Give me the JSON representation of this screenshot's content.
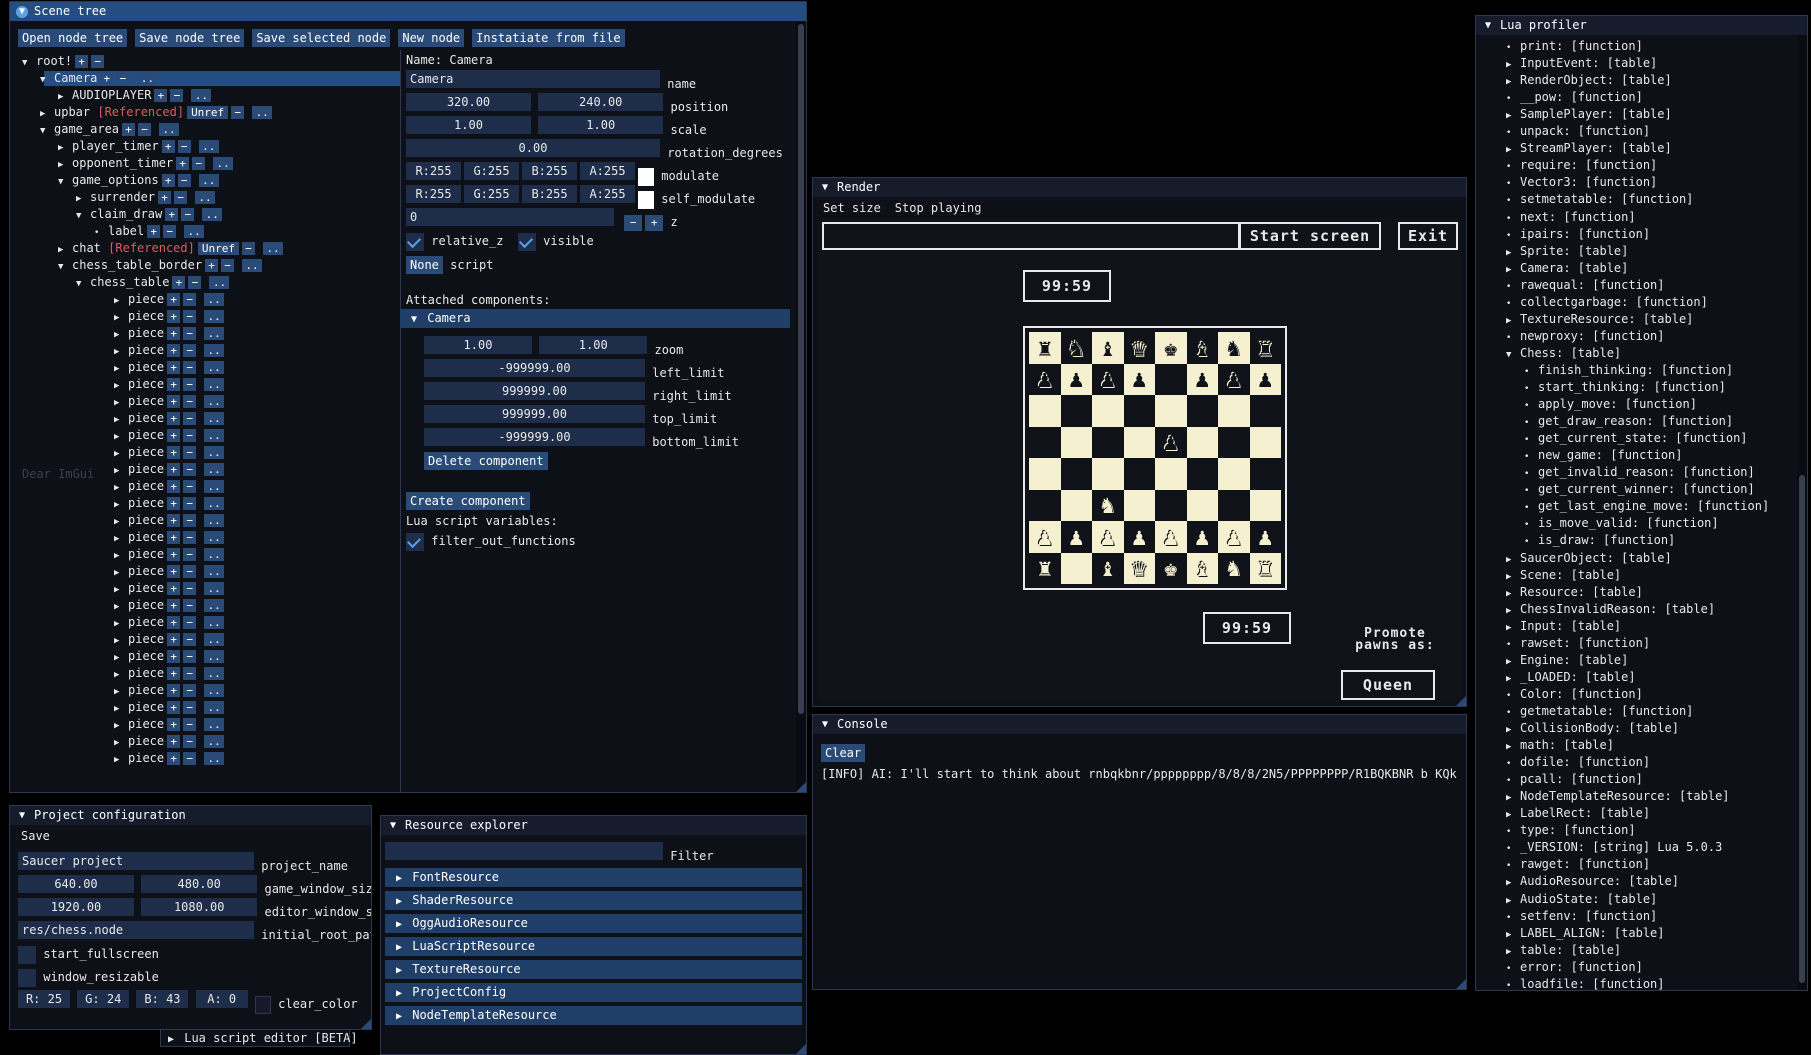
{
  "scene_tree": {
    "title": "Scene tree",
    "toolbar": [
      "Open node tree",
      "Save node tree",
      "Save selected node",
      "New node",
      "Instatiate from file"
    ],
    "nodes": [
      {
        "label": "root!",
        "arrow": "▼",
        "btns": [
          "+",
          "−"
        ]
      },
      {
        "label": "Camera",
        "arrow": "▼",
        "btns": [
          "+",
          "−",
          ".."
        ],
        "selected": true
      },
      {
        "label": "AUDIOPLAYER",
        "arrow": "▶",
        "btns": [
          "+",
          "−",
          ".."
        ]
      },
      {
        "label": "upbar",
        "arrow": "▶",
        "ref": "[Referenced]",
        "unref": "Unref",
        "btns": [
          "−",
          ".."
        ]
      },
      {
        "label": "game_area",
        "arrow": "▼",
        "btns": [
          "+",
          "−",
          ".."
        ]
      },
      {
        "label": "player_timer",
        "arrow": "▶",
        "btns": [
          "+",
          "−",
          ".."
        ]
      },
      {
        "label": "opponent_timer",
        "arrow": "▶",
        "btns": [
          "+",
          "−",
          ".."
        ]
      },
      {
        "label": "game_options",
        "arrow": "▼",
        "btns": [
          "+",
          "−",
          ".."
        ]
      },
      {
        "label": "surrender",
        "arrow": "▶",
        "btns": [
          "+",
          "−",
          ".."
        ]
      },
      {
        "label": "claim_draw",
        "arrow": "▼",
        "btns": [
          "+",
          "−",
          ".."
        ]
      },
      {
        "label": "label",
        "arrow": "•",
        "btns": [
          "+",
          "−",
          ".."
        ]
      },
      {
        "label": "chat",
        "arrow": "▶",
        "ref": "[Referenced]",
        "unref": "Unref",
        "btns": [
          "−",
          ".."
        ]
      },
      {
        "label": "chess_table_border",
        "arrow": "▼",
        "btns": [
          "+",
          "−",
          ".."
        ]
      },
      {
        "label": "chess_table",
        "arrow": "▼",
        "btns": [
          "+",
          "−",
          ".."
        ]
      }
    ],
    "piece_label": "piece",
    "ghost_label": "Dear ImGui",
    "inspector": {
      "name_line": "Name: Camera",
      "name_value": "Camera",
      "name_label": "name",
      "pos_x": "320.00",
      "pos_y": "240.00",
      "pos_label": "position",
      "scale_x": "1.00",
      "scale_y": "1.00",
      "scale_label": "scale",
      "rotation": "0.00",
      "rotation_label": "rotation_degrees",
      "modulate": [
        "R:255",
        "G:255",
        "B:255",
        "A:255"
      ],
      "modulate_label": "modulate",
      "self_modulate": [
        "R:255",
        "G:255",
        "B:255",
        "A:255"
      ],
      "self_modulate_label": "self_modulate",
      "z": "0",
      "z_minus": "−",
      "z_plus": "+",
      "z_label": "z",
      "relative_z": "relative_z",
      "visible": "visible",
      "script_btn": "None",
      "script_label": "script",
      "attached": "Attached components:",
      "component": "Camera",
      "zoom_x": "1.00",
      "zoom_y": "1.00",
      "zoom_label": "zoom",
      "left_limit": "-999999.00",
      "left_label": "left_limit",
      "right_limit": "999999.00",
      "right_label": "right_limit",
      "top_limit": "999999.00",
      "top_label": "top_limit",
      "bottom_limit": "-999999.00",
      "bottom_label": "bottom_limit",
      "delete_btn": "Delete component",
      "create_btn": "Create component",
      "lua_vars": "Lua script variables:",
      "filter_out": "filter_out_functions"
    }
  },
  "render": {
    "title": "Render",
    "menu": [
      "Set size",
      "Stop playing"
    ],
    "start_btn": "Start screen",
    "exit_btn": "Exit",
    "timer_top": "99:59",
    "timer_bottom": "99:59",
    "promote": "Promote pawns as:",
    "queen": "Queen",
    "board": [
      "rnbqkbnr",
      "pppp.ppp",
      "........",
      "....p...",
      "........",
      "..N.....",
      "PPPPPPPP",
      "R.BQKBNR"
    ]
  },
  "console": {
    "title": "Console",
    "clear": "Clear",
    "line": "[INFO]    AI: I'll start to think about rnbqkbnr/pppppppp/8/8/8/2N5/PPPPPPPP/R1BQKBNR b KQk"
  },
  "project": {
    "title": "Project configuration",
    "save": "Save",
    "project_name": "Saucer project",
    "project_name_label": "project_name",
    "gw_x": "640.00",
    "gw_y": "480.00",
    "gw_label": "game_window_size",
    "ew_x": "1920.00",
    "ew_y": "1080.00",
    "ew_label": "editor_window_si",
    "root_path": "res/chess.node",
    "root_label": "initial_root_pat",
    "fullscreen": "start_fullscreen",
    "resizable": "window_resizable",
    "clear": [
      "R: 25",
      "G: 24",
      "B: 43",
      "A:  0"
    ],
    "clear_label": "clear_color",
    "lua_editor": "Lua script editor [BETA]"
  },
  "resources": {
    "title": "Resource explorer",
    "filter": "Filter",
    "items": [
      "FontResource",
      "ShaderResource",
      "OggAudioResource",
      "LuaScriptResource",
      "TextureResource",
      "ProjectConfig",
      "NodeTemplateResource"
    ]
  },
  "profiler": {
    "title": "Lua profiler",
    "items": [
      {
        "t": "print: [function]",
        "a": "•",
        "d": 1
      },
      {
        "t": "InputEvent: [table]",
        "a": "▶",
        "d": 1
      },
      {
        "t": "RenderObject: [table]",
        "a": "▶",
        "d": 1
      },
      {
        "t": "__pow: [function]",
        "a": "•",
        "d": 1
      },
      {
        "t": "SamplePlayer: [table]",
        "a": "▶",
        "d": 1
      },
      {
        "t": "unpack: [function]",
        "a": "•",
        "d": 1
      },
      {
        "t": "StreamPlayer: [table]",
        "a": "▶",
        "d": 1
      },
      {
        "t": "require: [function]",
        "a": "•",
        "d": 1
      },
      {
        "t": "Vector3: [function]",
        "a": "•",
        "d": 1
      },
      {
        "t": "setmetatable: [function]",
        "a": "•",
        "d": 1
      },
      {
        "t": "next: [function]",
        "a": "•",
        "d": 1
      },
      {
        "t": "ipairs: [function]",
        "a": "•",
        "d": 1
      },
      {
        "t": "Sprite: [table]",
        "a": "▶",
        "d": 1
      },
      {
        "t": "Camera: [table]",
        "a": "▶",
        "d": 1
      },
      {
        "t": "rawequal: [function]",
        "a": "•",
        "d": 1
      },
      {
        "t": "collectgarbage: [function]",
        "a": "•",
        "d": 1
      },
      {
        "t": "TextureResource: [table]",
        "a": "▶",
        "d": 1
      },
      {
        "t": "newproxy: [function]",
        "a": "•",
        "d": 1
      },
      {
        "t": "Chess: [table]",
        "a": "▼",
        "d": 1
      },
      {
        "t": "finish_thinking: [function]",
        "a": "•",
        "d": 2
      },
      {
        "t": "start_thinking: [function]",
        "a": "•",
        "d": 2
      },
      {
        "t": "apply_move: [function]",
        "a": "•",
        "d": 2
      },
      {
        "t": "get_draw_reason: [function]",
        "a": "•",
        "d": 2
      },
      {
        "t": "get_current_state: [function]",
        "a": "•",
        "d": 2
      },
      {
        "t": "new_game: [function]",
        "a": "•",
        "d": 2
      },
      {
        "t": "get_invalid_reason: [function]",
        "a": "•",
        "d": 2
      },
      {
        "t": "get_current_winner: [function]",
        "a": "•",
        "d": 2
      },
      {
        "t": "get_last_engine_move: [function]",
        "a": "•",
        "d": 2
      },
      {
        "t": "is_move_valid: [function]",
        "a": "•",
        "d": 2
      },
      {
        "t": "is_draw: [function]",
        "a": "•",
        "d": 2
      },
      {
        "t": "SaucerObject: [table]",
        "a": "▶",
        "d": 1
      },
      {
        "t": "Scene: [table]",
        "a": "▶",
        "d": 1
      },
      {
        "t": "Resource: [table]",
        "a": "▶",
        "d": 1
      },
      {
        "t": "ChessInvalidReason: [table]",
        "a": "▶",
        "d": 1
      },
      {
        "t": "Input: [table]",
        "a": "▶",
        "d": 1
      },
      {
        "t": "rawset: [function]",
        "a": "•",
        "d": 1
      },
      {
        "t": "Engine: [table]",
        "a": "▶",
        "d": 1
      },
      {
        "t": "_LOADED: [table]",
        "a": "▶",
        "d": 1
      },
      {
        "t": "Color: [function]",
        "a": "•",
        "d": 1
      },
      {
        "t": "getmetatable: [function]",
        "a": "•",
        "d": 1
      },
      {
        "t": "CollisionBody: [table]",
        "a": "▶",
        "d": 1
      },
      {
        "t": "math: [table]",
        "a": "▶",
        "d": 1
      },
      {
        "t": "dofile: [function]",
        "a": "•",
        "d": 1
      },
      {
        "t": "pcall: [function]",
        "a": "•",
        "d": 1
      },
      {
        "t": "NodeTemplateResource: [table]",
        "a": "▶",
        "d": 1
      },
      {
        "t": "LabelRect: [table]",
        "a": "▶",
        "d": 1
      },
      {
        "t": "type: [function]",
        "a": "•",
        "d": 1
      },
      {
        "t": "_VERSION: [string]    Lua 5.0.3",
        "a": "•",
        "d": 1
      },
      {
        "t": "rawget: [function]",
        "a": "•",
        "d": 1
      },
      {
        "t": "AudioResource: [table]",
        "a": "▶",
        "d": 1
      },
      {
        "t": "AudioState: [table]",
        "a": "▶",
        "d": 1
      },
      {
        "t": "setfenv: [function]",
        "a": "•",
        "d": 1
      },
      {
        "t": "LABEL_ALIGN: [table]",
        "a": "▶",
        "d": 1
      },
      {
        "t": "table: [table]",
        "a": "▶",
        "d": 1
      },
      {
        "t": "error: [function]",
        "a": "•",
        "d": 1
      },
      {
        "t": "loadfile: [function]",
        "a": "•",
        "d": 1
      }
    ]
  },
  "colors": {
    "accent": "#2a4a78",
    "title_active": "#244d82",
    "panel": "#0e1018",
    "board_light": "#f5f0d0",
    "board_dark": "#10121a",
    "ref": "#e05a5a"
  }
}
